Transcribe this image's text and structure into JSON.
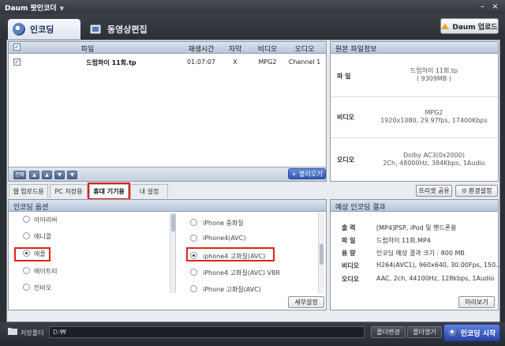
{
  "window": {
    "title": "Daum 팟인코더"
  },
  "main_tabs": [
    {
      "label": "인코딩",
      "active": true
    },
    {
      "label": "동영상편집",
      "active": false
    }
  ],
  "upload_button": "Daum 업로드",
  "file_list": {
    "columns": [
      "파일",
      "재생시간",
      "자막",
      "비디오",
      "오디오"
    ],
    "rows": [
      {
        "checked": true,
        "file": "드럽하이 11회.tp",
        "duration": "01:07:07",
        "subtitle": "X",
        "video": "MPG2",
        "audio": "Channel 1"
      }
    ],
    "load_button": "불러오기",
    "mini_buttons": [
      "전체",
      "▲",
      "▲",
      "▼",
      "▼"
    ]
  },
  "source_info": {
    "title": "원본 파일정보",
    "file_label": "파 일",
    "file_name": "드럽하이 11회.tp",
    "file_size": "( 9309MB )",
    "video_label": "비디오",
    "video_codec": "MPG2",
    "video_detail": "1920x1080, 29.97fps, 17400Kbps",
    "audio_label": "오디오",
    "audio_codec": "Dolby AC3(0x2000)",
    "audio_detail": "2Ch, 48000Hz, 384Kbps, 1Audio"
  },
  "sub_tabs": [
    {
      "label": "웹 업로드용",
      "active": false
    },
    {
      "label": "PC 저장용",
      "active": false
    },
    {
      "label": "휴대 기기용",
      "active": true
    },
    {
      "label": "내 설정",
      "active": false
    }
  ],
  "preset_share_button": "프리셋 공유",
  "settings_button": "환경설정",
  "encoding_options": {
    "title": "인코딩 옵션",
    "makers": [
      {
        "label": "아이리버",
        "selected": false
      },
      {
        "label": "애니콜",
        "selected": false
      },
      {
        "label": "애플",
        "selected": true
      },
      {
        "label": "에이트리",
        "selected": false
      },
      {
        "label": "인비오",
        "selected": false
      }
    ],
    "models": [
      {
        "label": "iPhone 중화질",
        "selected": false
      },
      {
        "label": "iPhone4(AVC)",
        "selected": false
      },
      {
        "label": "iphone4 고화질(AVC)",
        "selected": true
      },
      {
        "label": "iPhone4 고화질(AVC) VBR",
        "selected": false
      },
      {
        "label": "iPhone 고화질(AVC)",
        "selected": false
      }
    ],
    "detail_button": "세부설정"
  },
  "expected_result": {
    "title": "예상 인코딩 결과",
    "rows": [
      {
        "label": "출 력",
        "value": "[MP4]PSP, iPod 및 핸드폰용"
      },
      {
        "label": "파 일",
        "value": "드럽하이 11회.MP4"
      },
      {
        "label": "용 량",
        "value": "인코딩 예상 결과 크기 : 800 MB"
      },
      {
        "label": "비디오",
        "value": "H264(AVC1), 960x640, 30.00Fps, 150..."
      },
      {
        "label": "오디오",
        "value": "AAC, 2ch, 44100Hz, 128kbps, 1Audio"
      }
    ],
    "preview_button": "미리보기"
  },
  "bottom": {
    "folder_label": "저장폴더",
    "folder_path": "D:₩",
    "change_button": "폴더변경",
    "open_button": "폴더열기",
    "start_button": "인코딩 시작"
  }
}
